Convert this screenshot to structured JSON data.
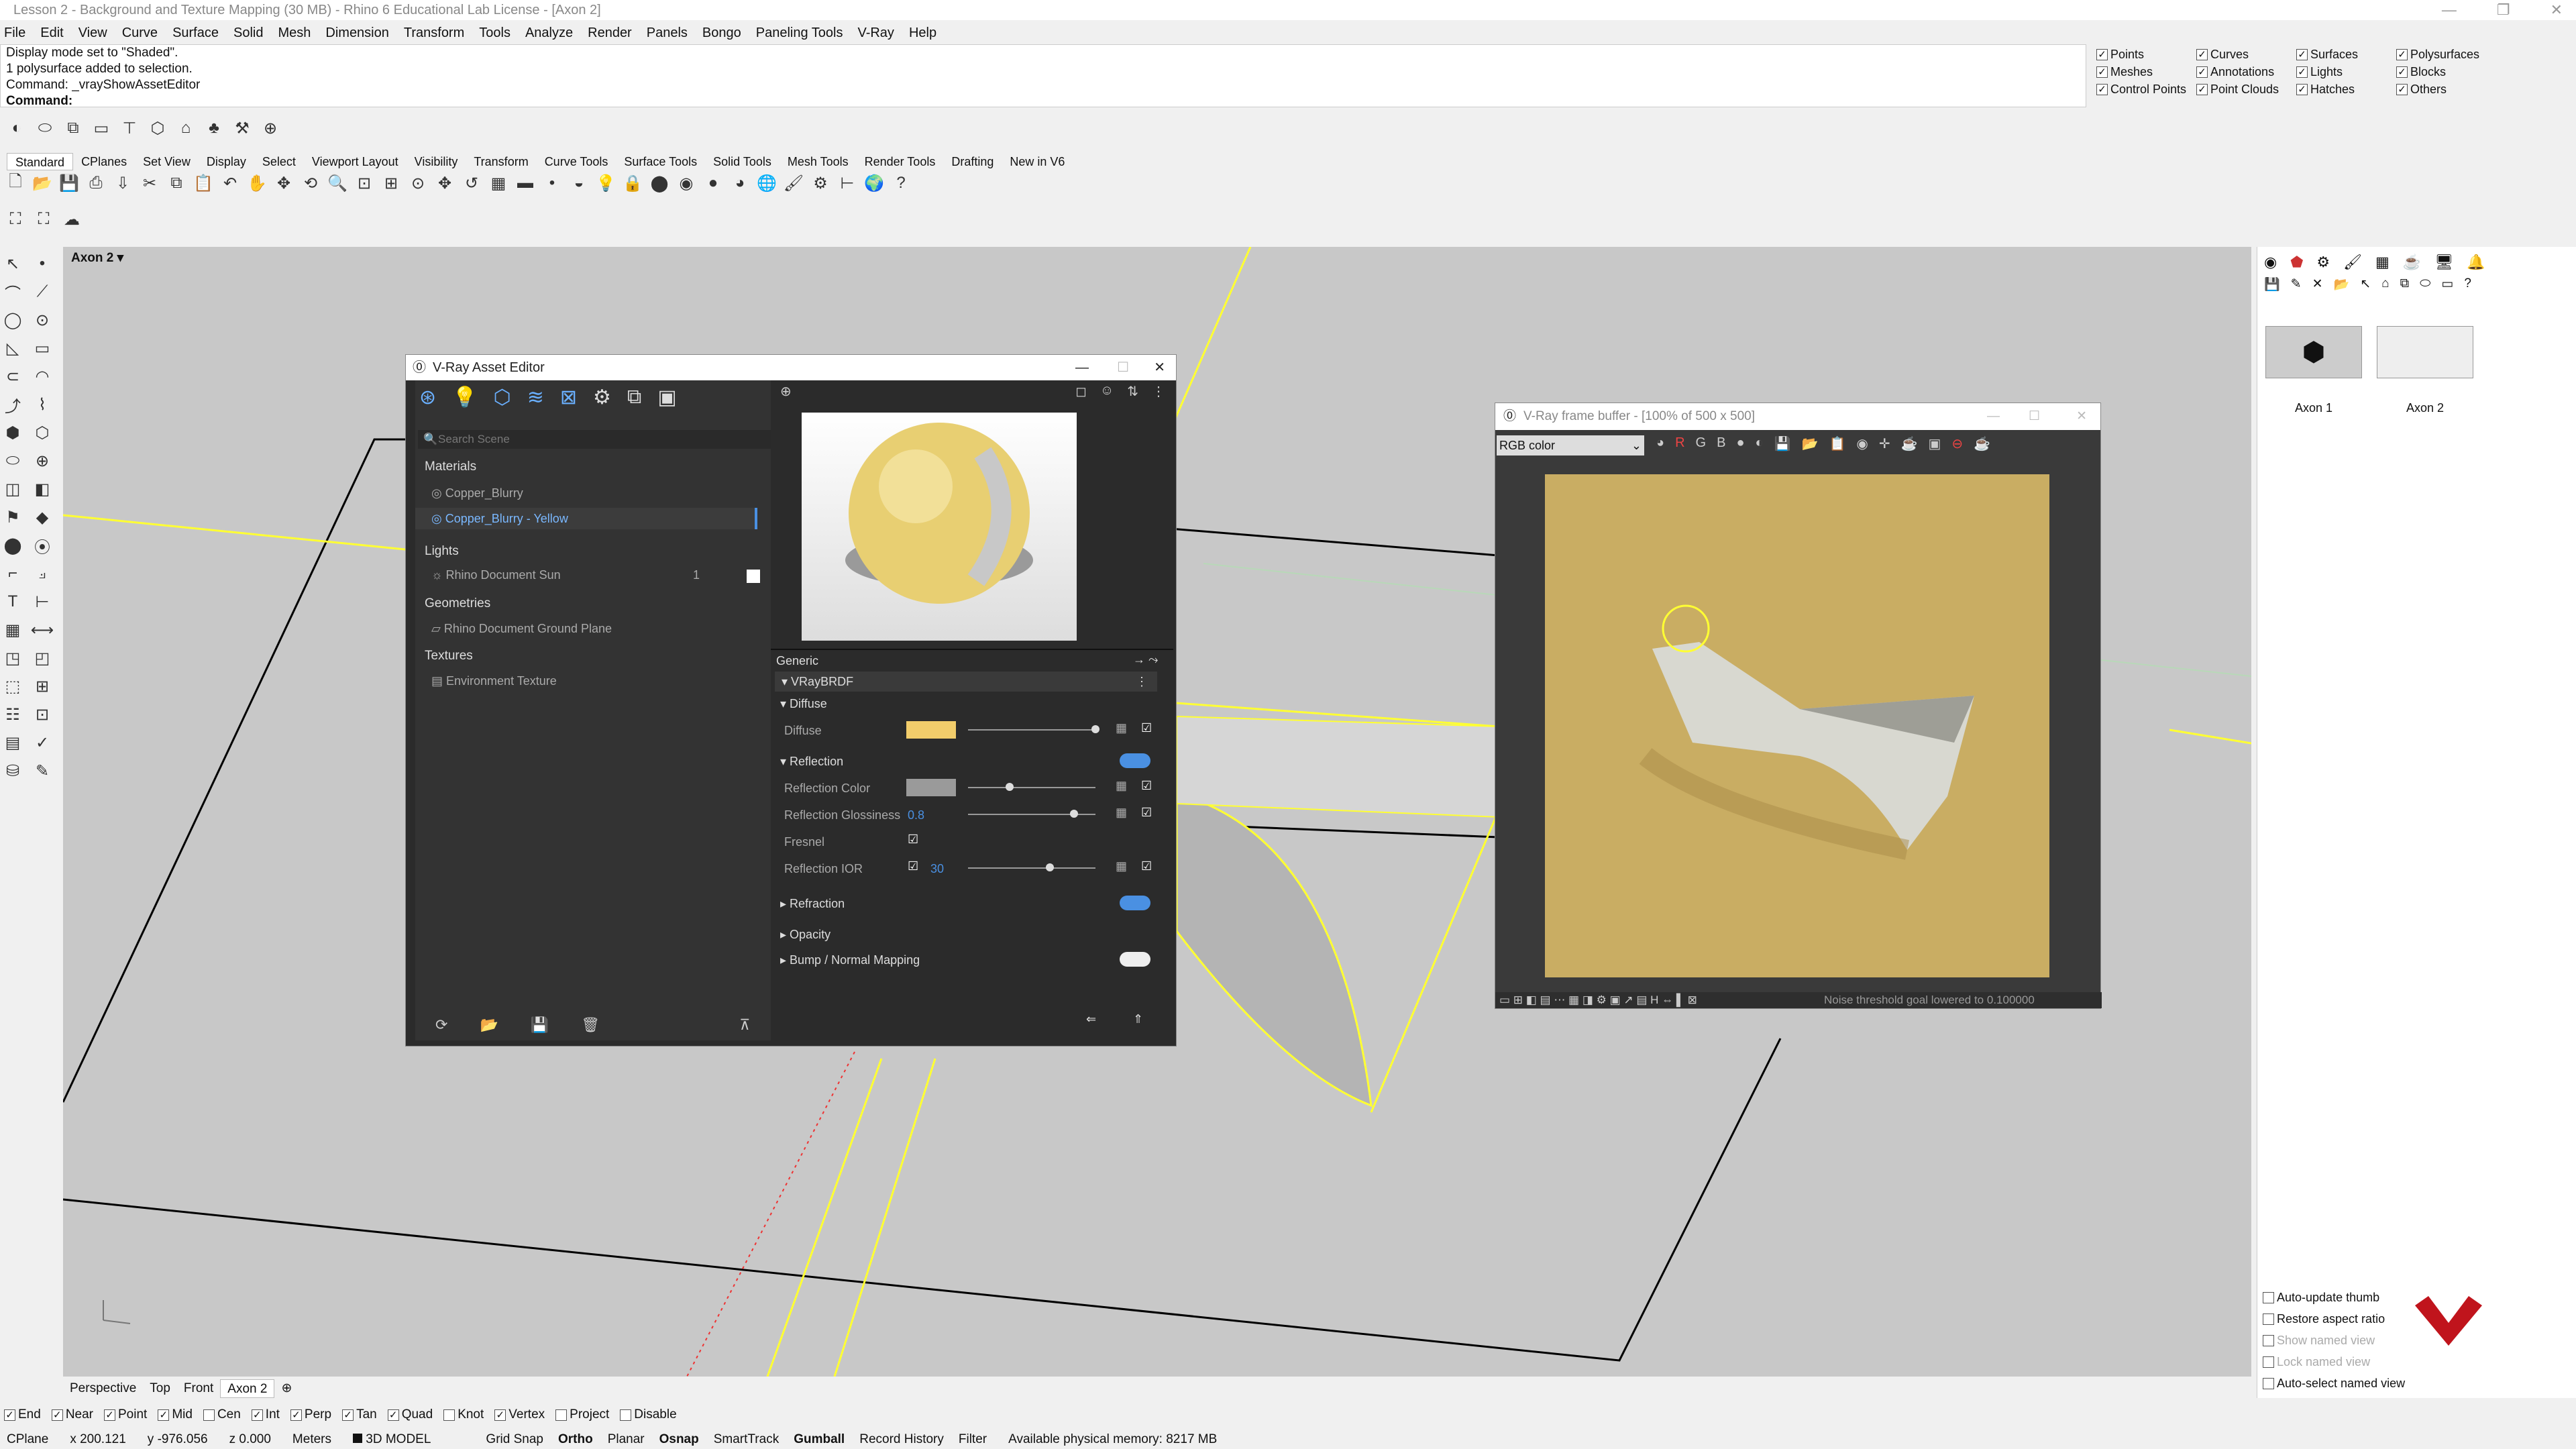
{
  "window": {
    "title": "Lesson 2 - Background and Texture Mapping (30 MB) - Rhino 6 Educational Lab License - [Axon 2]"
  },
  "menu": [
    "File",
    "Edit",
    "View",
    "Curve",
    "Surface",
    "Solid",
    "Mesh",
    "Dimension",
    "Transform",
    "Tools",
    "Analyze",
    "Render",
    "Panels",
    "Bongo",
    "Paneling Tools",
    "V-Ray",
    "Help"
  ],
  "command": {
    "history": [
      "Display mode set to \"Shaded\".",
      "1 polysurface added to selection.",
      "Command: _vrayShowAssetEditor"
    ],
    "prompt": "Command:"
  },
  "filters": [
    {
      "label": "Points",
      "checked": true
    },
    {
      "label": "Curves",
      "checked": true
    },
    {
      "label": "Surfaces",
      "checked": true
    },
    {
      "label": "Polysurfaces",
      "checked": true
    },
    {
      "label": "Meshes",
      "checked": true
    },
    {
      "label": "Annotations",
      "checked": true
    },
    {
      "label": "Lights",
      "checked": true
    },
    {
      "label": "Blocks",
      "checked": true
    },
    {
      "label": "Control Points",
      "checked": true
    },
    {
      "label": "Point Clouds",
      "checked": true
    },
    {
      "label": "Hatches",
      "checked": true
    },
    {
      "label": "Others",
      "checked": true
    }
  ],
  "toolbar_tabs": [
    "Standard",
    "CPlanes",
    "Set View",
    "Display",
    "Select",
    "Viewport Layout",
    "Visibility",
    "Transform",
    "Curve Tools",
    "Surface Tools",
    "Solid Tools",
    "Mesh Tools",
    "Render Tools",
    "Drafting",
    "New in V6"
  ],
  "viewport": {
    "label": "Axon 2"
  },
  "asset_editor": {
    "title": "V-Ray Asset Editor",
    "search_placeholder": "Search Scene",
    "sections": {
      "materials": "Materials",
      "lights": "Lights",
      "geometries": "Geometries",
      "textures": "Textures"
    },
    "materials": [
      "Copper_Blurry",
      "Copper_Blurry - Yellow"
    ],
    "lights": [
      {
        "name": "Rhino Document Sun",
        "count": "1"
      }
    ],
    "geometries": [
      "Rhino Document Ground Plane"
    ],
    "textures": [
      "Environment Texture"
    ],
    "props": {
      "generic": "Generic",
      "brdf": "VRayBRDF",
      "diffuse_section": "Diffuse",
      "diffuse": "Diffuse",
      "diffuse_color": "#f2cd6b",
      "reflection_section": "Reflection",
      "reflection_color": "Reflection Color",
      "reflection_glossiness": "Reflection Glossiness",
      "glossiness_value": "0.8",
      "fresnel": "Fresnel",
      "reflection_ior": "Reflection IOR",
      "ior_value": "30",
      "refraction": "Refraction",
      "opacity": "Opacity",
      "bump": "Bump / Normal Mapping"
    }
  },
  "frame_buffer": {
    "title": "V-Ray frame buffer - [100% of 500 x 500]",
    "channel": "RGB color",
    "status": "Noise threshold goal lowered to 0.100000",
    "bg_color": "#c9ad63"
  },
  "named_views": {
    "views": [
      "Axon 1",
      "Axon 2"
    ],
    "settings": [
      {
        "label": "Auto-update thumb",
        "checked": false,
        "enabled": true
      },
      {
        "label": "Restore aspect ratio",
        "checked": false,
        "enabled": true
      },
      {
        "label": "Show named view",
        "checked": false,
        "enabled": false
      },
      {
        "label": "Lock named view",
        "checked": false,
        "enabled": false
      },
      {
        "label": "Auto-select named view",
        "checked": false,
        "enabled": true
      }
    ]
  },
  "view_tabs": [
    "Perspective",
    "Top",
    "Front",
    "Axon 2"
  ],
  "osnaps": [
    {
      "label": "End",
      "checked": true
    },
    {
      "label": "Near",
      "checked": true
    },
    {
      "label": "Point",
      "checked": true
    },
    {
      "label": "Mid",
      "checked": true
    },
    {
      "label": "Cen",
      "checked": false
    },
    {
      "label": "Int",
      "checked": true
    },
    {
      "label": "Perp",
      "checked": true
    },
    {
      "label": "Tan",
      "checked": true
    },
    {
      "label": "Quad",
      "checked": true
    },
    {
      "label": "Knot",
      "checked": false
    },
    {
      "label": "Vertex",
      "checked": true
    },
    {
      "label": "Project",
      "checked": false
    },
    {
      "label": "Disable",
      "checked": false
    }
  ],
  "status": {
    "cplane": "CPlane",
    "x": "x 200.121",
    "y": "y -976.056",
    "z": "z 0.000",
    "units": "Meters",
    "layer": "3D MODEL",
    "toggles": [
      "Grid Snap",
      "Ortho",
      "Planar",
      "Osnap",
      "SmartTrack",
      "Gumball",
      "Record History",
      "Filter"
    ],
    "memory": "Available physical memory: 8217 MB"
  }
}
